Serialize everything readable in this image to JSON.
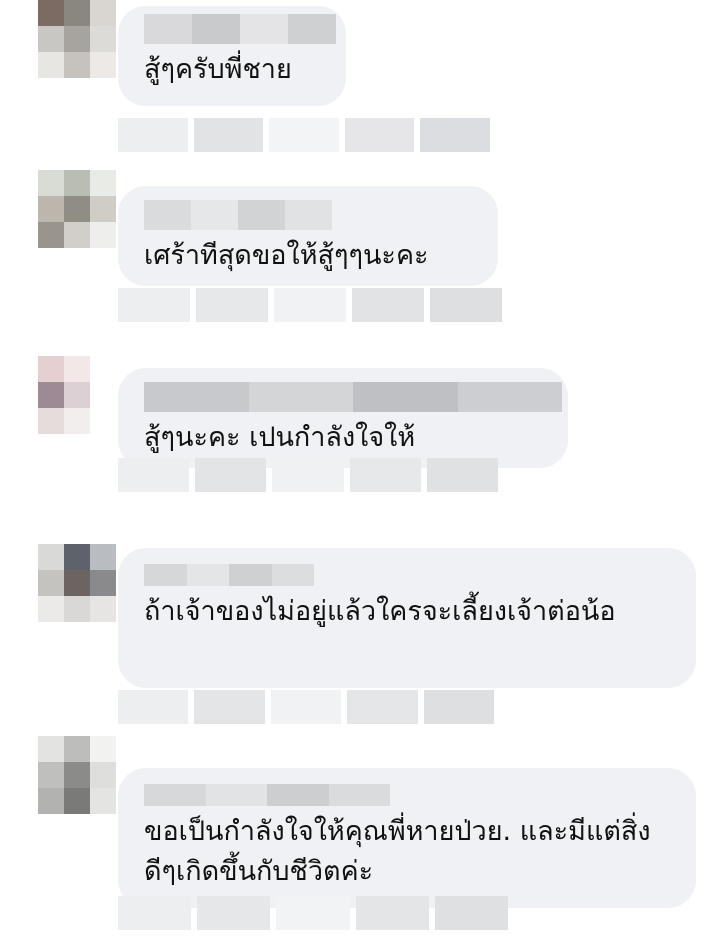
{
  "comments": [
    {
      "text": "สู้ๆครับพี่ชาย",
      "author_blurred": true,
      "avatar_colors": [
        "#7c6b63",
        "#8a8680",
        "#d9d6d2",
        "#c9c7c3",
        "#a7a4a0",
        "#dddbd8",
        "#e8e6e3",
        "#c6c3bf",
        "#ece9e6"
      ],
      "author_bar_colors": [
        "#d9d9db",
        "#c9cacc",
        "#e4e4e6",
        "#cfd0d2"
      ],
      "action_bar_colors": [
        "#eceef0",
        "#e2e3e5",
        "#f3f4f5",
        "#e6e6e8",
        "#dcdde0"
      ]
    },
    {
      "text": "เศร้าทีสุดขอให้สู้ๆๆนะคะ",
      "author_blurred": true,
      "avatar_colors": [
        "#d8dcd4",
        "#b9bdb4",
        "#e9ebe7",
        "#bdb6ad",
        "#8f8d84",
        "#cfcdc6",
        "#9a958c",
        "#d1cfca",
        "#eeeeec"
      ],
      "author_bar_colors": [
        "#dadbdc",
        "#e6e7e8",
        "#d2d3d5",
        "#e1e2e3"
      ],
      "action_bar_colors": [
        "#eceef0",
        "#e7e8ea",
        "#f1f2f3",
        "#e2e3e5",
        "#dedfe1"
      ]
    },
    {
      "text": "สู้ๆนะคะ เปนกำลังใจให้",
      "author_blurred": true,
      "avatar_colors": [
        "#e5cfd0",
        "#f1e8e7",
        "#ffffff",
        "#9d8a94",
        "#ddd0d5",
        "#ffffff",
        "#e6dcdc",
        "#f3eeee",
        "#ffffff"
      ],
      "author_bar_colors": [
        "#c8c9cc",
        "#d4d5d7",
        "#bfc0c3",
        "#cdced1"
      ],
      "action_bar_colors": [
        "#eceef0",
        "#e3e4e6",
        "#f0f1f2",
        "#e7e8ea",
        "#e0e1e3"
      ]
    },
    {
      "text": "ถ้าเจ้าของไม่อยู่แล้วใครจะเลี้ยงเจ้าต่อน้อ",
      "author_blurred": true,
      "avatar_colors": [
        "#d9d9d8",
        "#5e636b",
        "#b9bcc0",
        "#c5c3c0",
        "#6c6461",
        "#8a8a8c",
        "#eceae8",
        "#dad8d6",
        "#e6e5e4"
      ],
      "author_bar_colors": [
        "#d6d7d9",
        "#e4e5e6",
        "#cfd0d2",
        "#dcdddf"
      ],
      "action_bar_colors": [
        "#eceef0",
        "#e4e5e7",
        "#f1f2f3",
        "#e5e6e8",
        "#dedfe1"
      ]
    },
    {
      "text": "ขอเป็นกำลังใจให้คุณพี่หายป่วย.  และมีแต่สิ่งดีๆเกิดขึ้นกับชีวิตค่ะ",
      "author_blurred": true,
      "avatar_colors": [
        "#e3e3e2",
        "#bdbdbb",
        "#f2f2f1",
        "#bfbfbd",
        "#8b8b89",
        "#dededc",
        "#b2b2b0",
        "#7a7a78",
        "#e4e4e2"
      ],
      "author_bar_colors": [
        "#d7d8da",
        "#e2e3e4",
        "#cdced0",
        "#dadbdc"
      ],
      "action_bar_colors": [
        "#eceef0",
        "#e6e7e9",
        "#f2f3f4",
        "#e4e5e7",
        "#dfe0e2"
      ]
    }
  ]
}
